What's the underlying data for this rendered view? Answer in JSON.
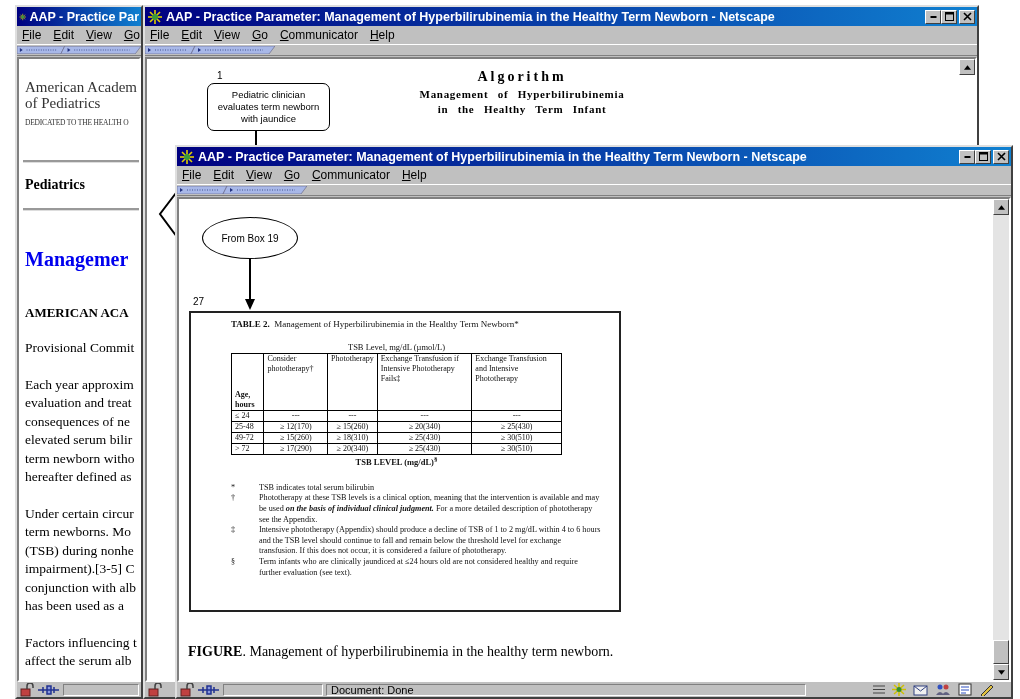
{
  "back_window": {
    "title": "AAP - Practice Par",
    "menu": [
      "File",
      "Edit",
      "View",
      "Go"
    ],
    "logo_lines": [
      "American Academ",
      "of Pediatrics"
    ],
    "tagline": "DEDICATED TO THE HEALTH O",
    "journal": "Pediatrics",
    "heading": "Managemer",
    "byline": "AMERICAN ACA",
    "committee": "Provisional Commit",
    "paragraphs": [
      [
        "Each year approxim",
        "evaluation and treat",
        "consequences of ne",
        "elevated serum bilir",
        "term newborn witho",
        "hereafter defined as"
      ],
      [
        "Under certain circur",
        "term newborns. Mo",
        "(TSB) during nonhe",
        "impairment).[3-5] C",
        "conjunction with alb",
        "has been used as a"
      ],
      [
        "Factors influencing t",
        "affect the serum alb"
      ]
    ]
  },
  "middle_window": {
    "title": "AAP - Practice Parameter: Management of Hyperbilirubinemia in the Healthy Term Newborn - Netscape",
    "menu": [
      "File",
      "Edit",
      "View",
      "Go",
      "Communicator",
      "Help"
    ],
    "step_number": "1",
    "step_box": "Pediatric clinician evaluates term newborn with jaundice",
    "algorithm_title": "Algorithm",
    "algorithm_subtitle": [
      "Management of Hyperbilirubinemia",
      "in the Healthy Term Infant"
    ]
  },
  "front_window": {
    "title": "AAP - Practice Parameter: Management of Hyperbilirubinemia in the Healthy Term Newborn - Netscape",
    "menu": [
      "File",
      "Edit",
      "View",
      "Go",
      "Communicator",
      "Help"
    ],
    "oval": "From Box 19",
    "step_number": "27",
    "table": {
      "title": "**TABLE 2.**  Management of Hyperbilirubinemia in the Healthy Term Newborn*",
      "header_note": "TSB Level, mg/dL (µmol/L)",
      "columns": [
        "Age, hours",
        "Consider phototherapy†",
        "Phototherapy",
        "Exchange Transfusion if Intensive Phototherapy Fails‡",
        "Exchange Transfusion and Intensive Phototherapy"
      ],
      "rows": [
        [
          "≤ 24",
          "---",
          "---",
          "---",
          "---"
        ],
        [
          "25-48",
          "≥ 12(170)",
          "≥ 15(260)",
          "≥ 20(340)",
          "≥ 25(430)"
        ],
        [
          "49-72",
          "≥ 15(260)",
          "≥ 18(310)",
          "≥ 25(430)",
          "≥ 30(510)"
        ],
        [
          "> 72",
          "≥ 17(290)",
          "≥ 20(340)",
          "≥ 25(430)",
          "≥ 30(510)"
        ]
      ],
      "footer": "TSB LEVEL (mg/dL)$^{§}$",
      "footnotes": [
        {
          "symbol": "*",
          "text": "TSB indicates total serum bilirubin"
        },
        {
          "symbol": "†",
          "text": "Phototherapy at these TSB levels is a clinical option, meaning that the intervention is available and may be used **on the basis of individual clinical judgment.**  For a more detailed description of phototherapy see the Appendix."
        },
        {
          "symbol": "‡",
          "text": "Intensive phototherapy (Appendix) should produce a decline of TSB of 1 to 2 mg/dL within 4 to 6 hours and the TSB level should continue to fall and remain below the threshold level for exchange transfusion.  If this does not occur, it is considered a failure of phototherapy."
        },
        {
          "symbol": "§",
          "text": "Term infants who are clinically jaundiced at ≤24 hours old are not considered healthy and require further evaluation (see text)."
        }
      ]
    },
    "caption": "**FIGURE**. Management of hyperbilirubinemia in the healthy term newborn.",
    "status": "Document: Done"
  }
}
